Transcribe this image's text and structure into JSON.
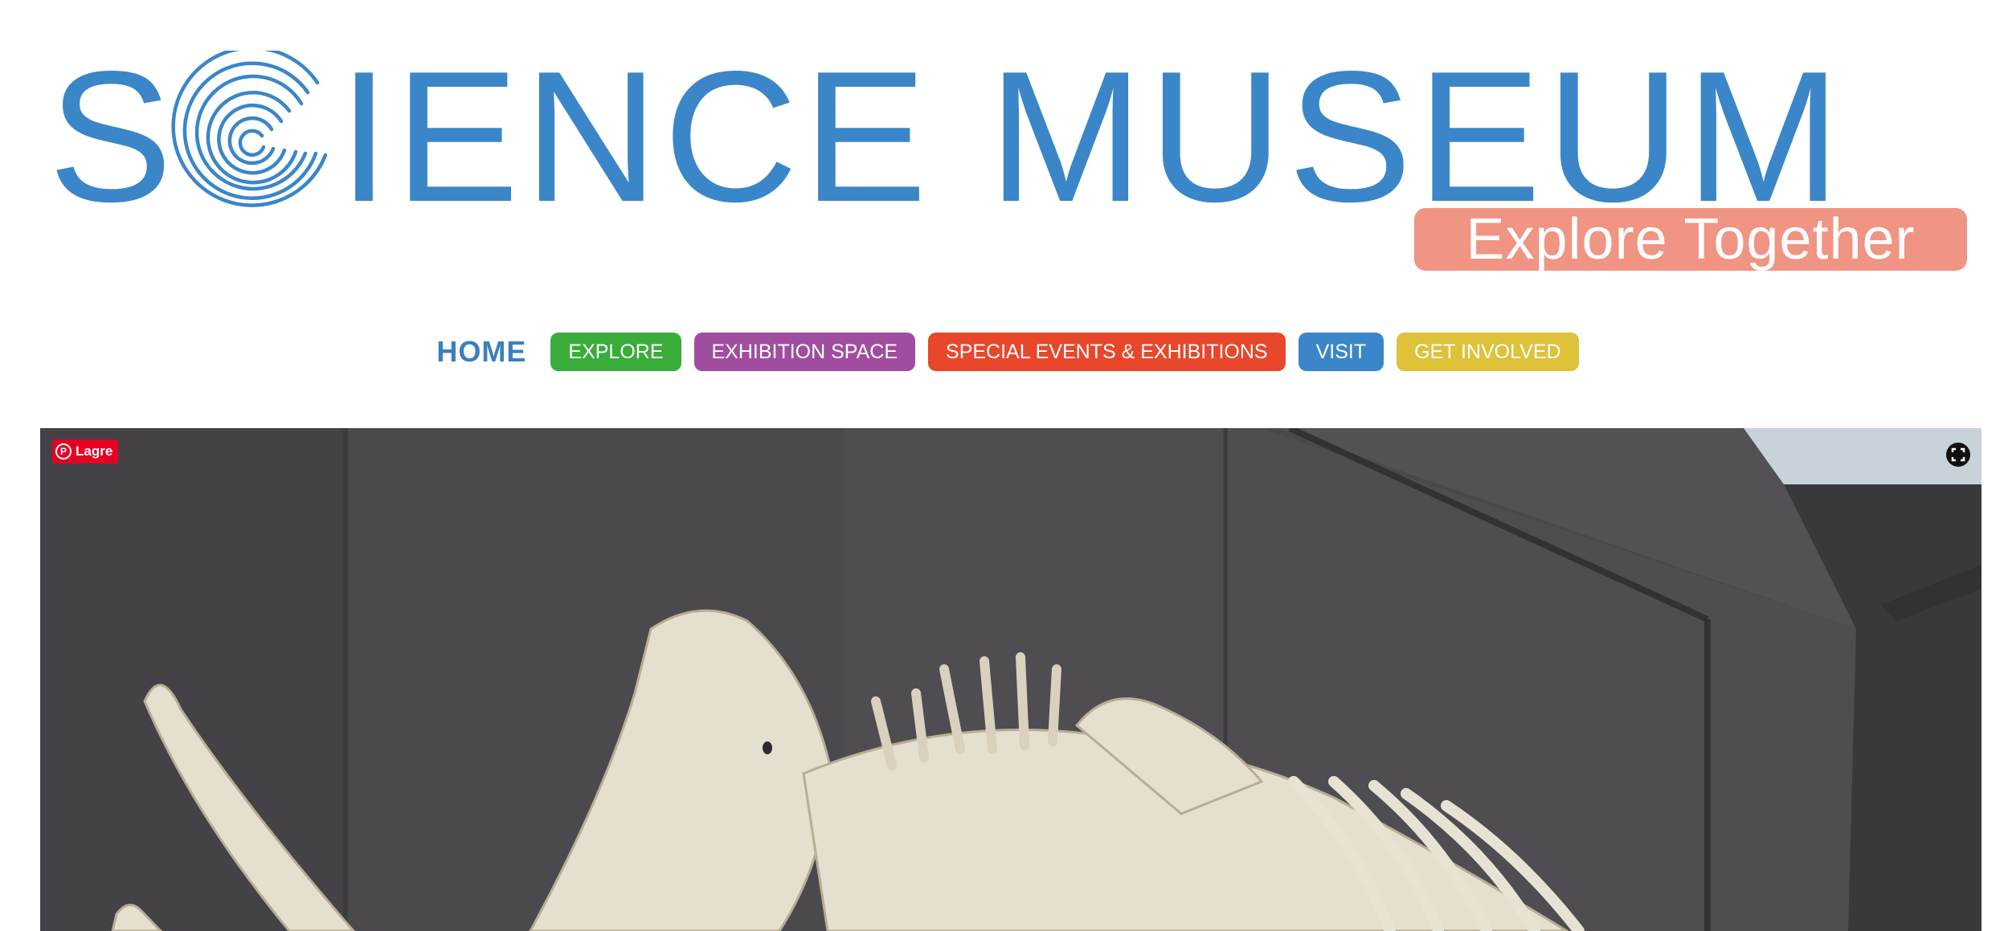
{
  "logo": {
    "letters": [
      "S",
      "",
      "I",
      "E",
      "N",
      "C",
      "E",
      " ",
      "M",
      "U",
      "S",
      "E",
      "U",
      "M"
    ],
    "tagline": "Explore Together",
    "color": "#3a86c8",
    "tagline_bg": "#f09483"
  },
  "nav": {
    "home": "HOME",
    "items": [
      {
        "label": "EXPLORE",
        "color": "#3aac3a"
      },
      {
        "label": "EXHIBITION SPACE",
        "color": "#a04da0"
      },
      {
        "label": "SPECIAL EVENTS & EXHIBITIONS",
        "color": "#e8472b"
      },
      {
        "label": "VISIT",
        "color": "#3a86c8"
      },
      {
        "label": "GET INVOLVED",
        "color": "#ddc23a"
      }
    ]
  },
  "hero": {
    "pin_label": "Lagre",
    "pin_icon": "pinterest-icon",
    "fullscreen_icon": "fullscreen-icon"
  }
}
